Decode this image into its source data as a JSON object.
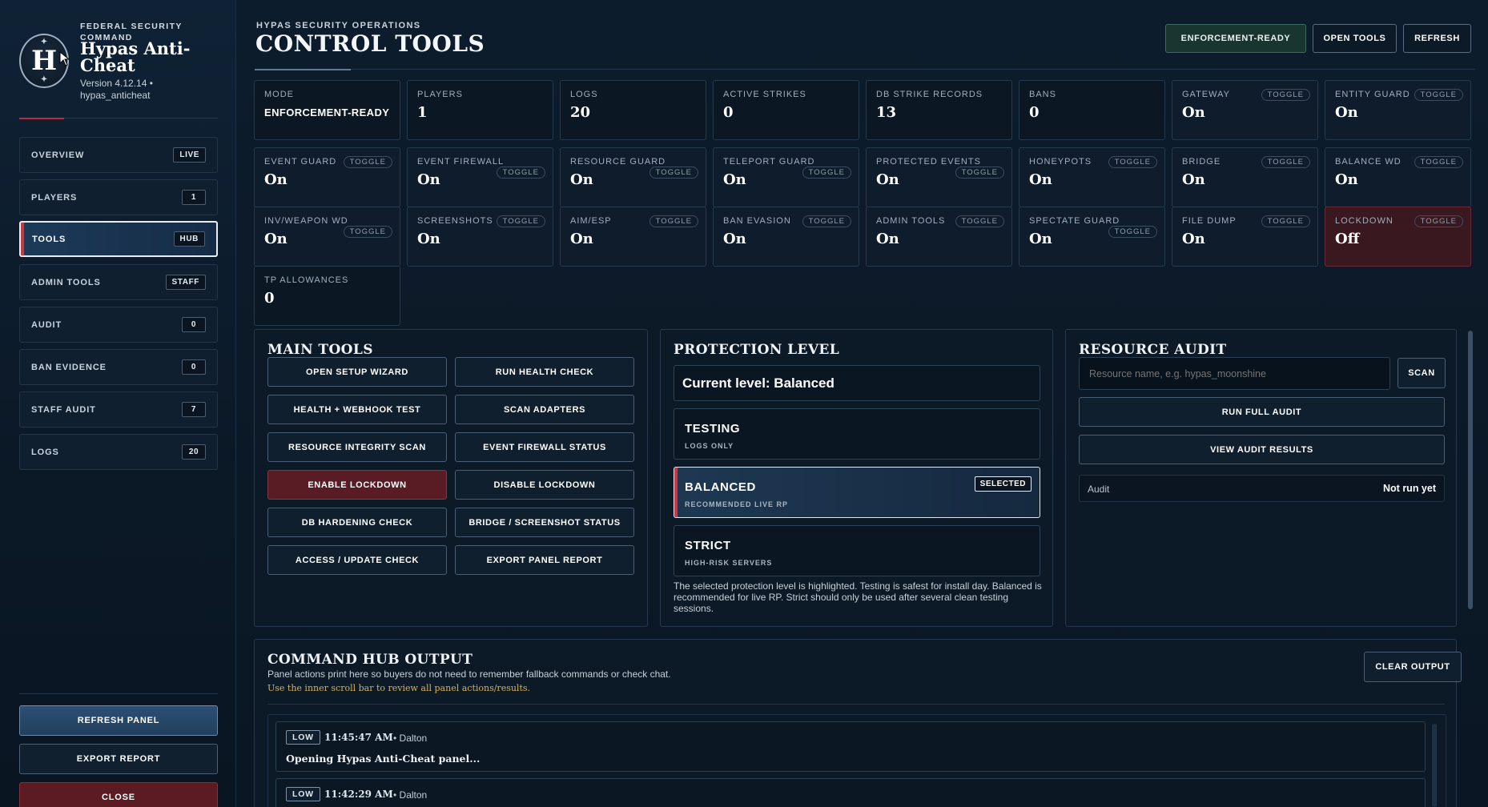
{
  "brand": {
    "kicker": "FEDERAL SECURITY COMMAND",
    "name": "Hypas Anti-Cheat",
    "version": "Version 4.12.14 • hypas_anticheat",
    "logo_letter": "H"
  },
  "nav": [
    {
      "label": "OVERVIEW",
      "badge": "LIVE"
    },
    {
      "label": "PLAYERS",
      "badge": "1"
    },
    {
      "label": "TOOLS",
      "badge": "HUB"
    },
    {
      "label": "ADMIN TOOLS",
      "badge": "STAFF"
    },
    {
      "label": "AUDIT",
      "badge": "0"
    },
    {
      "label": "BAN EVIDENCE",
      "badge": "0"
    },
    {
      "label": "STAFF AUDIT",
      "badge": "7"
    },
    {
      "label": "LOGS",
      "badge": "20"
    }
  ],
  "sidebar_actions": {
    "refresh": "REFRESH PANEL",
    "export": "EXPORT REPORT",
    "close": "CLOSE"
  },
  "header": {
    "kicker": "HYPAS SECURITY OPERATIONS",
    "title": "CONTROL TOOLS",
    "mode_button": "ENFORCEMENT-READY",
    "open_tools": "OPEN TOOLS",
    "refresh": "REFRESH"
  },
  "toggle_label": "TOGGLE",
  "stats": [
    {
      "label": "MODE",
      "value": "ENFORCEMENT-READY"
    },
    {
      "label": "PLAYERS",
      "value": "1"
    },
    {
      "label": "LOGS",
      "value": "20"
    },
    {
      "label": "ACTIVE STRIKES",
      "value": "0"
    },
    {
      "label": "DB STRIKE RECORDS",
      "value": "13"
    },
    {
      "label": "BANS",
      "value": "0"
    },
    {
      "label": "GATEWAY",
      "value": "On"
    },
    {
      "label": "ENTITY GUARD",
      "value": "On"
    },
    {
      "label": "EVENT GUARD",
      "value": "On"
    },
    {
      "label": "EVENT FIREWALL",
      "value": "On"
    },
    {
      "label": "RESOURCE GUARD",
      "value": "On"
    },
    {
      "label": "TELEPORT GUARD",
      "value": "On"
    },
    {
      "label": "PROTECTED EVENTS",
      "value": "On"
    },
    {
      "label": "HONEYPOTS",
      "value": "On"
    },
    {
      "label": "BRIDGE",
      "value": "On"
    },
    {
      "label": "BALANCE WD",
      "value": "On"
    },
    {
      "label": "INV/WEAPON WD",
      "value": "On"
    },
    {
      "label": "SCREENSHOTS",
      "value": "On"
    },
    {
      "label": "AIM/ESP",
      "value": "On"
    },
    {
      "label": "BAN EVASION",
      "value": "On"
    },
    {
      "label": "ADMIN TOOLS",
      "value": "On"
    },
    {
      "label": "SPECTATE GUARD",
      "value": "On"
    },
    {
      "label": "FILE DUMP",
      "value": "On"
    },
    {
      "label": "LOCKDOWN",
      "value": "Off"
    },
    {
      "label": "TP ALLOWANCES",
      "value": "0"
    }
  ],
  "main_tools": {
    "title": "MAIN TOOLS",
    "buttons": [
      "OPEN SETUP WIZARD",
      "RUN HEALTH CHECK",
      "HEALTH + WEBHOOK TEST",
      "SCAN ADAPTERS",
      "RESOURCE INTEGRITY SCAN",
      "EVENT FIREWALL STATUS",
      "ENABLE LOCKDOWN",
      "DISABLE LOCKDOWN",
      "DB HARDENING CHECK",
      "BRIDGE / SCREENSHOT STATUS",
      "ACCESS / UPDATE CHECK",
      "EXPORT PANEL REPORT"
    ]
  },
  "protection": {
    "title": "PROTECTION LEVEL",
    "current": "Current level: Balanced",
    "levels": [
      {
        "name": "TESTING",
        "sub": "LOGS ONLY"
      },
      {
        "name": "BALANCED",
        "sub": "RECOMMENDED LIVE RP",
        "badge": "SELECTED"
      },
      {
        "name": "STRICT",
        "sub": "HIGH-RISK SERVERS"
      }
    ],
    "note": "The selected protection level is highlighted. Testing is safest for install day. Balanced is recommended for live RP. Strict should only be used after several clean testing sessions."
  },
  "resource_audit": {
    "title": "RESOURCE AUDIT",
    "placeholder": "Resource name, e.g. hypas_moonshine",
    "scan": "SCAN",
    "run_full": "RUN FULL AUDIT",
    "view_results": "VIEW AUDIT RESULTS",
    "status_label": "Audit",
    "status_value": "Not run yet"
  },
  "output": {
    "title": "COMMAND HUB OUTPUT",
    "desc": "Panel actions print here so buyers do not need to remember fallback commands or check chat.",
    "hint": "Use the inner scroll bar to review all panel actions/results.",
    "clear": "CLEAR OUTPUT",
    "entries": [
      {
        "severity": "LOW",
        "time": "11:45:47 AM",
        "user": "• Dalton",
        "message": "Opening Hypas Anti-Cheat panel..."
      },
      {
        "severity": "LOW",
        "time": "11:42:29 AM",
        "user": "• Dalton",
        "message": ""
      }
    ]
  },
  "colors": {
    "accent_red": "#c53a43",
    "enforcement_green": "#18362f",
    "danger_bg": "#5a1c24"
  }
}
